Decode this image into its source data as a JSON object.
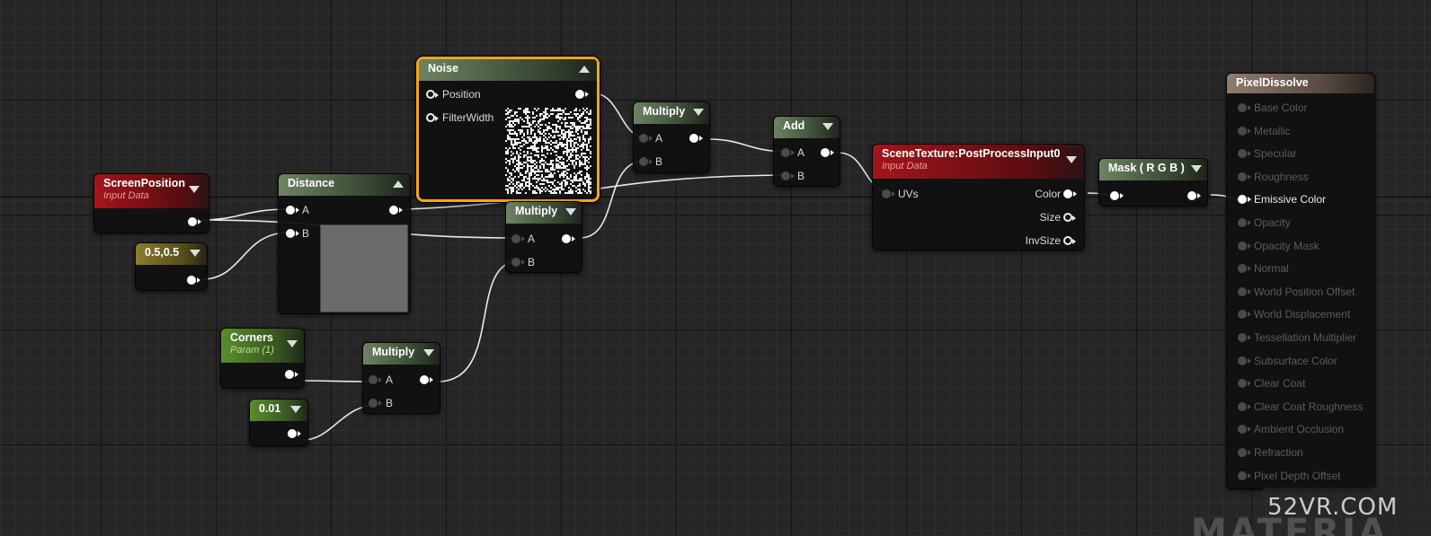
{
  "nodes": {
    "screen_position": {
      "title": "ScreenPosition",
      "subtitle": "Input Data"
    },
    "half": {
      "title": "0.5,0.5"
    },
    "distance": {
      "title": "Distance",
      "pin_a": "A",
      "pin_b": "B"
    },
    "noise": {
      "title": "Noise",
      "pin_position": "Position",
      "pin_filter_width": "FilterWidth"
    },
    "multiply_top": {
      "title": "Multiply",
      "pin_a": "A",
      "pin_b": "B"
    },
    "multiply_mid": {
      "title": "Multiply",
      "pin_a": "A",
      "pin_b": "B"
    },
    "multiply_bottom": {
      "title": "Multiply",
      "pin_a": "A",
      "pin_b": "B"
    },
    "corners": {
      "title": "Corners",
      "subtitle": "Param (1)"
    },
    "constant": {
      "title": "0.01"
    },
    "add": {
      "title": "Add",
      "pin_a": "A",
      "pin_b": "B"
    },
    "scene_texture": {
      "title": "SceneTexture:PostProcessInput0",
      "subtitle": "Input Data",
      "pin_uvs": "UVs",
      "pin_color": "Color",
      "pin_size": "Size",
      "pin_invsize": "InvSize"
    },
    "mask": {
      "title": "Mask ( R G B )"
    },
    "result": {
      "title": "PixelDissolve",
      "inputs": [
        "Base Color",
        "Metallic",
        "Specular",
        "Roughness",
        "Emissive Color",
        "Opacity",
        "Opacity Mask",
        "Normal",
        "World Position Offset",
        "World Displacement",
        "Tessellation Multiplier",
        "Subsurface Color",
        "Clear Coat",
        "Clear Coat Roughness",
        "Ambient Occlusion",
        "Refraction",
        "Pixel Depth Offset"
      ],
      "active_input": "Emissive Color"
    }
  },
  "watermark": {
    "site": "52VR.COM",
    "overlay": "MATERIA"
  },
  "colors": {
    "selection": "#f3a51c",
    "wire": "#ffffff",
    "input_header": "#a3151b",
    "param_header": "#5a8d2e"
  }
}
